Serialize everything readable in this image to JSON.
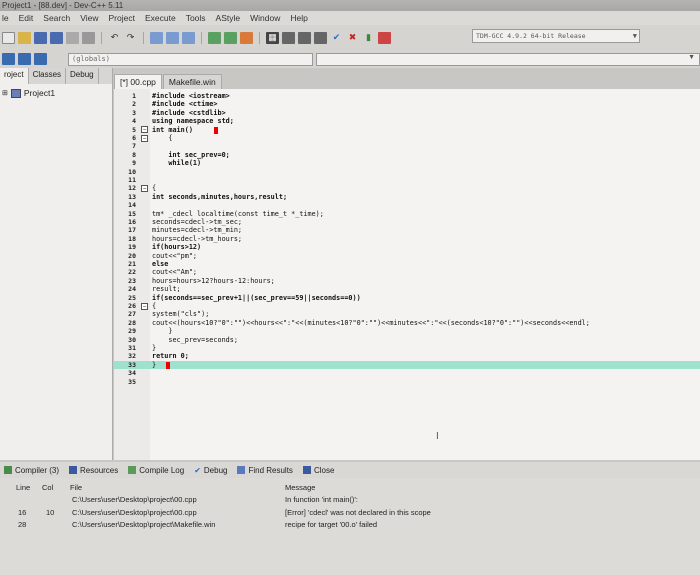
{
  "window": {
    "title": "Project1 - [88.dev] - Dev-C++ 5.11"
  },
  "menu": [
    "le",
    "Edit",
    "Search",
    "View",
    "Project",
    "Execute",
    "Tools",
    "AStyle",
    "Window",
    "Help"
  ],
  "toolbar": {
    "compiler": "TDM-GCC 4.9.2 64-bit Release",
    "globals": "(globals)"
  },
  "project_pane": {
    "tabs": [
      "roject",
      "Classes",
      "Debug"
    ],
    "root": "Project1"
  },
  "editor": {
    "tabs": [
      "[*] 00.cpp",
      "Makefile.win"
    ],
    "lines": [
      {
        "n": "1",
        "fold": "",
        "code": "#include <iostream>"
      },
      {
        "n": "2",
        "fold": "",
        "code": "#include <ctime>"
      },
      {
        "n": "3",
        "fold": "",
        "code": "#include <cstdlib>"
      },
      {
        "n": "4",
        "fold": "",
        "code": "using namespace std;"
      },
      {
        "n": "5",
        "fold": "−",
        "code": "int main()"
      },
      {
        "n": "6",
        "fold": "−",
        "code": "    {"
      },
      {
        "n": "7",
        "fold": "",
        "code": ""
      },
      {
        "n": "8",
        "fold": "",
        "code": "    int sec_prev=0;"
      },
      {
        "n": "9",
        "fold": "",
        "code": "    while(1)"
      },
      {
        "n": "10",
        "fold": "",
        "code": ""
      },
      {
        "n": "11",
        "fold": "",
        "code": ""
      },
      {
        "n": "12",
        "fold": "−",
        "code": "{"
      },
      {
        "n": "13",
        "fold": "",
        "code": "int seconds,minutes,hours,result;"
      },
      {
        "n": "14",
        "fold": "",
        "code": ""
      },
      {
        "n": "15",
        "fold": "",
        "code": "tm* _cdecl localtime(const time_t *_time);"
      },
      {
        "n": "16",
        "fold": "",
        "code": "seconds=cdecl->tm_sec;"
      },
      {
        "n": "17",
        "fold": "",
        "code": "minutes=cdecl->tm_min;"
      },
      {
        "n": "18",
        "fold": "",
        "code": "hours=cdecl->tm_hours;"
      },
      {
        "n": "19",
        "fold": "",
        "code": "if(hours>12)"
      },
      {
        "n": "20",
        "fold": "",
        "code": "cout<<\"pm\";"
      },
      {
        "n": "21",
        "fold": "",
        "code": "else"
      },
      {
        "n": "22",
        "fold": "",
        "code": "cout<<\"Am\";"
      },
      {
        "n": "23",
        "fold": "",
        "code": "hours=hours>12?hours-12:hours;"
      },
      {
        "n": "24",
        "fold": "",
        "code": "result;"
      },
      {
        "n": "25",
        "fold": "",
        "code": "if(seconds==sec_prev+1||(sec_prev==59||seconds==0))"
      },
      {
        "n": "26",
        "fold": "−",
        "code": "{"
      },
      {
        "n": "27",
        "fold": "",
        "code": "system(\"cls\");"
      },
      {
        "n": "28",
        "fold": "",
        "code": "cout<<(hours<10?\"0\":\"\")<<hours<<\":\"<<(minutes<10?\"0\":\"\")<<minutes<<\":\"<<(seconds<10?\"0\":\"\")<<seconds<<endl;"
      },
      {
        "n": "29",
        "fold": "",
        "code": "    }"
      },
      {
        "n": "30",
        "fold": "",
        "code": "    sec_prev=seconds;"
      },
      {
        "n": "31",
        "fold": "",
        "code": "}"
      },
      {
        "n": "32",
        "fold": "",
        "code": "return 0;"
      },
      {
        "n": "33",
        "fold": "",
        "code": "}"
      },
      {
        "n": "34",
        "fold": "",
        "code": ""
      },
      {
        "n": "35",
        "fold": "",
        "code": ""
      }
    ]
  },
  "bottom": {
    "tabs": [
      "Compiler (3)",
      "Resources",
      "Compile Log",
      "Debug",
      "Find Results",
      "Close"
    ],
    "headers": [
      "Line",
      "Col",
      "File",
      "Message"
    ],
    "rows": [
      {
        "line": "",
        "col": "",
        "file": "C:\\Users\\user\\Desktop\\project\\00.cpp",
        "message": "In function 'int main()':"
      },
      {
        "line": "16",
        "col": "10",
        "file": "C:\\Users\\user\\Desktop\\project\\00.cpp",
        "message": "[Error] 'cdecl' was not declared in this scope"
      },
      {
        "line": "28",
        "col": "",
        "file": "C:\\Users\\user\\Desktop\\project\\Makefile.win",
        "message": "recipe for target '00.o' failed"
      }
    ]
  }
}
